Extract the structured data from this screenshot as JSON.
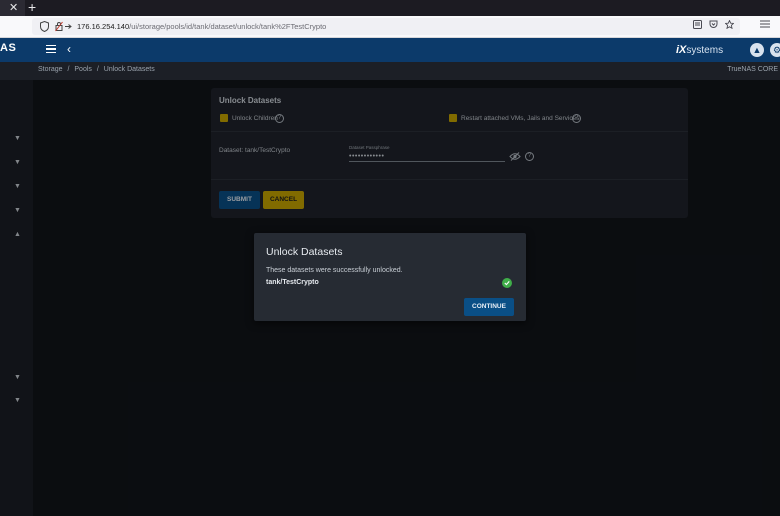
{
  "browser": {
    "tab_close": "✕",
    "tab_new": "+",
    "url_host": "176.16.254.140",
    "url_path": "/ui/storage/pools/id/tank/dataset/unlock/tank%2FTestCrypto"
  },
  "header": {
    "brand_left": "AS",
    "ix_logo": "iX",
    "ix_logo_text": "systems"
  },
  "breadcrumb": {
    "items": [
      "Storage",
      "/",
      "Pools",
      "/",
      "Unlock Datasets"
    ],
    "product": "TrueNAS CORE"
  },
  "form": {
    "title": "Unlock Datasets",
    "unlock_children_label": "Unlock Children",
    "restart_services_label": "Restart attached VMs, Jails and Services",
    "dataset_label": "Dataset: tank/TestCrypto",
    "passphrase_caption": "Dataset Passphrase",
    "passphrase_value": "••••••••••••",
    "submit_label": "SUBMIT",
    "cancel_label": "CANCEL"
  },
  "dialog": {
    "title": "Unlock Datasets",
    "message": "These datasets were successfully unlocked.",
    "dataset": "tank/TestCrypto",
    "continue_label": "CONTINUE"
  },
  "colors": {
    "header_blue": "#0c3a6a",
    "accent_yellow": "#c7a500",
    "button_blue": "#0a4f86",
    "success_green": "#3fae49"
  }
}
